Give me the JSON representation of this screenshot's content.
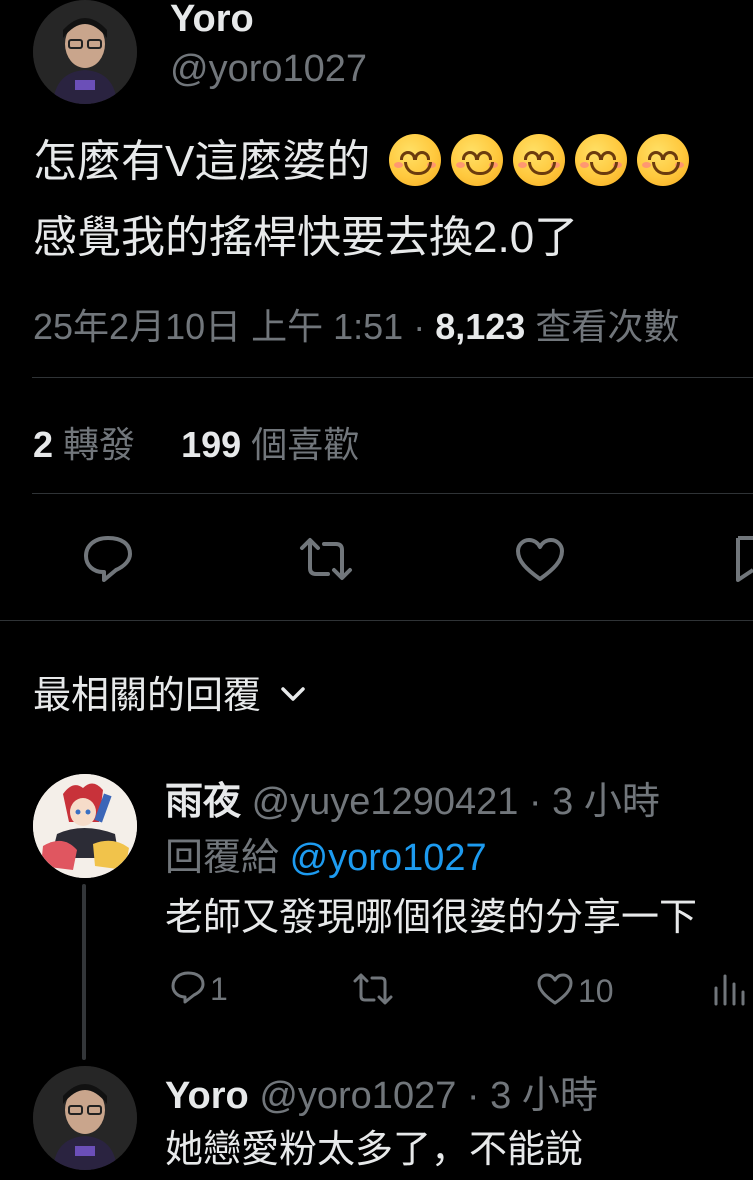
{
  "tweet": {
    "author_name": "Yoro",
    "author_handle": "@yoro1027",
    "text_line1": "怎麼有V這麼婆的",
    "text_line2": "感覺我的搖桿快要去換2.0了",
    "emojis": [
      "smiling-face-icon",
      "smiling-face-icon",
      "smiling-face-icon",
      "smiling-face-icon",
      "smiling-face-icon"
    ],
    "timestamp": "25年2月10日 上午 1:51",
    "dot": "·",
    "views_count": "8,123",
    "views_label": "查看次數",
    "retweets_count": "2",
    "retweets_label": "轉發",
    "likes_count": "199",
    "likes_label": "個喜歡"
  },
  "replies_header": {
    "label": "最相關的回覆"
  },
  "replies": [
    {
      "name": "雨夜",
      "handle": "@yuye1290421",
      "time": "· 3 小時",
      "reply_to_label": "回覆給",
      "reply_to_handle": "@yoro1027",
      "text": "老師又發現哪個很婆的分享一下",
      "reply_count": "1",
      "like_count": "10"
    },
    {
      "name": "Yoro",
      "handle": "@yoro1027",
      "time": "· 3 小時",
      "text": "她戀愛粉太多了，不能說"
    }
  ],
  "colors": {
    "background": "#000000",
    "text": "#e7e9ea",
    "muted": "#71767b",
    "link": "#1d9bf0",
    "divider": "#2f3336"
  }
}
